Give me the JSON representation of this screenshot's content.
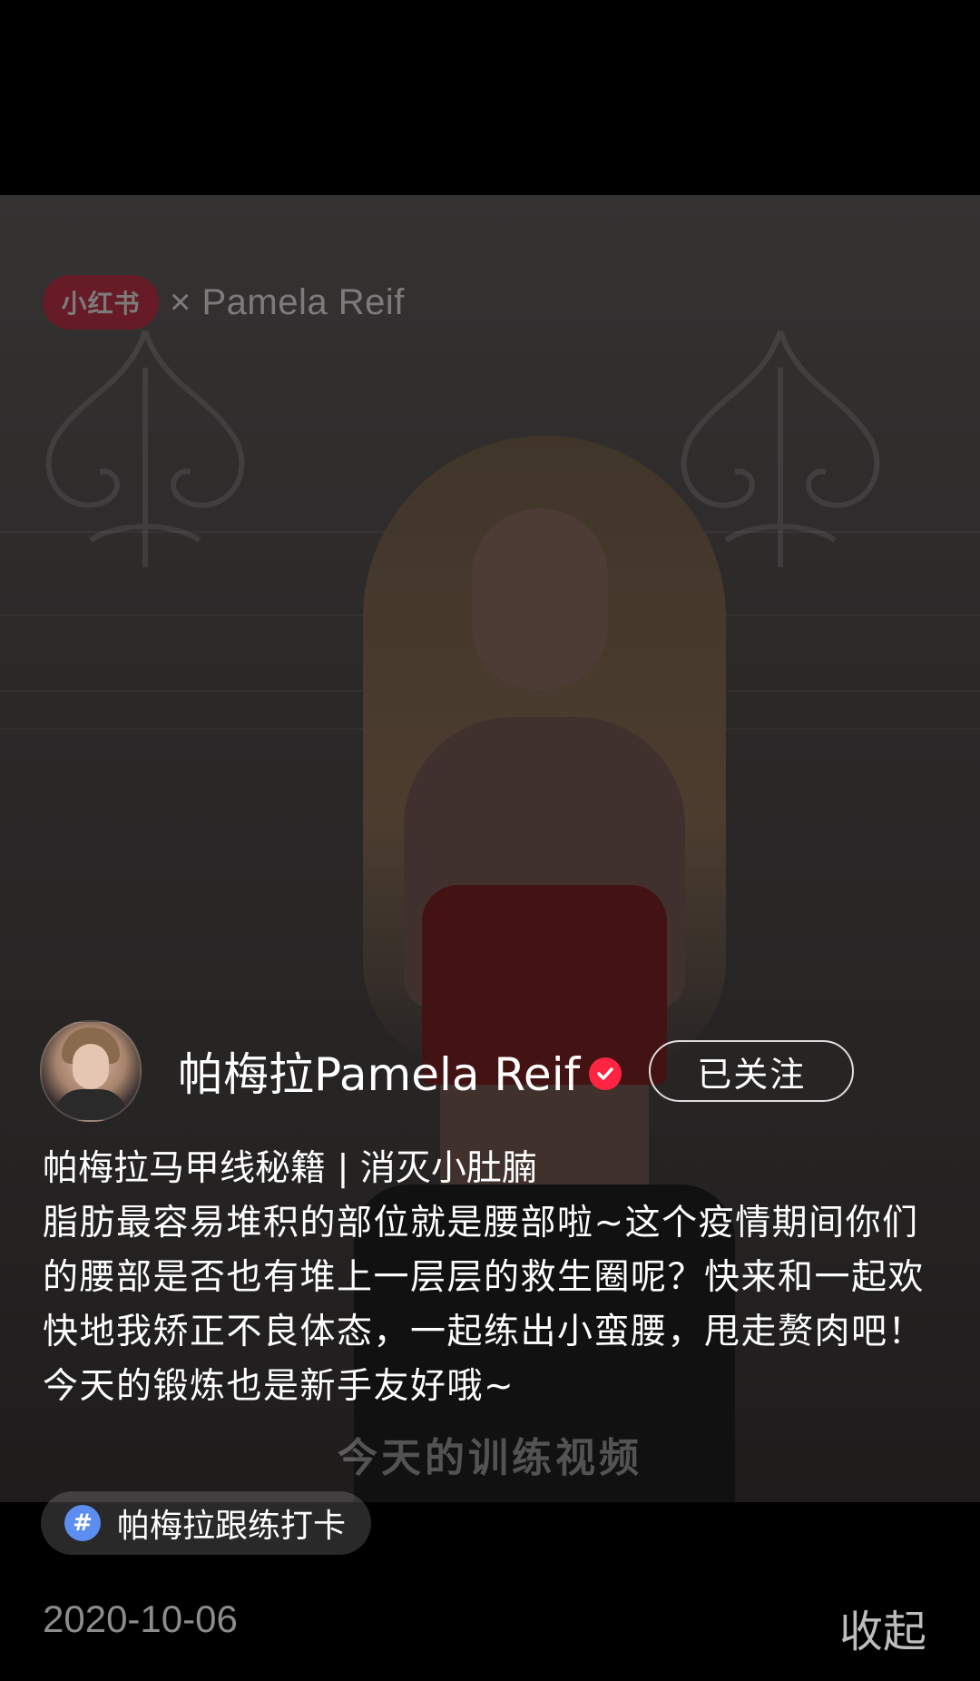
{
  "video": {
    "watermark_logo": "小红书",
    "watermark_text": "× Pamela Reif",
    "subtitle": "今天的训练视频"
  },
  "author": {
    "name": "帕梅拉Pamela Reif",
    "verified": true,
    "follow_label": "已关注",
    "verified_color": "#ff2442"
  },
  "post": {
    "title": "帕梅拉马甲线秘籍 | 消灭小肚腩",
    "text": "脂肪最容易堆积的部位就是腰部啦~这个疫情期间你们的腰部是否也有堆上一层层的救生圈呢？快来和一起欢快地我矫正不良体态，一起练出小蛮腰，甩走赘肉吧！今天的锻炼也是新手友好哦~",
    "hashtag_icon": "#",
    "hashtag_label": "帕梅拉跟练打卡",
    "date": "2020-10-06",
    "collapse_label": "收起"
  }
}
